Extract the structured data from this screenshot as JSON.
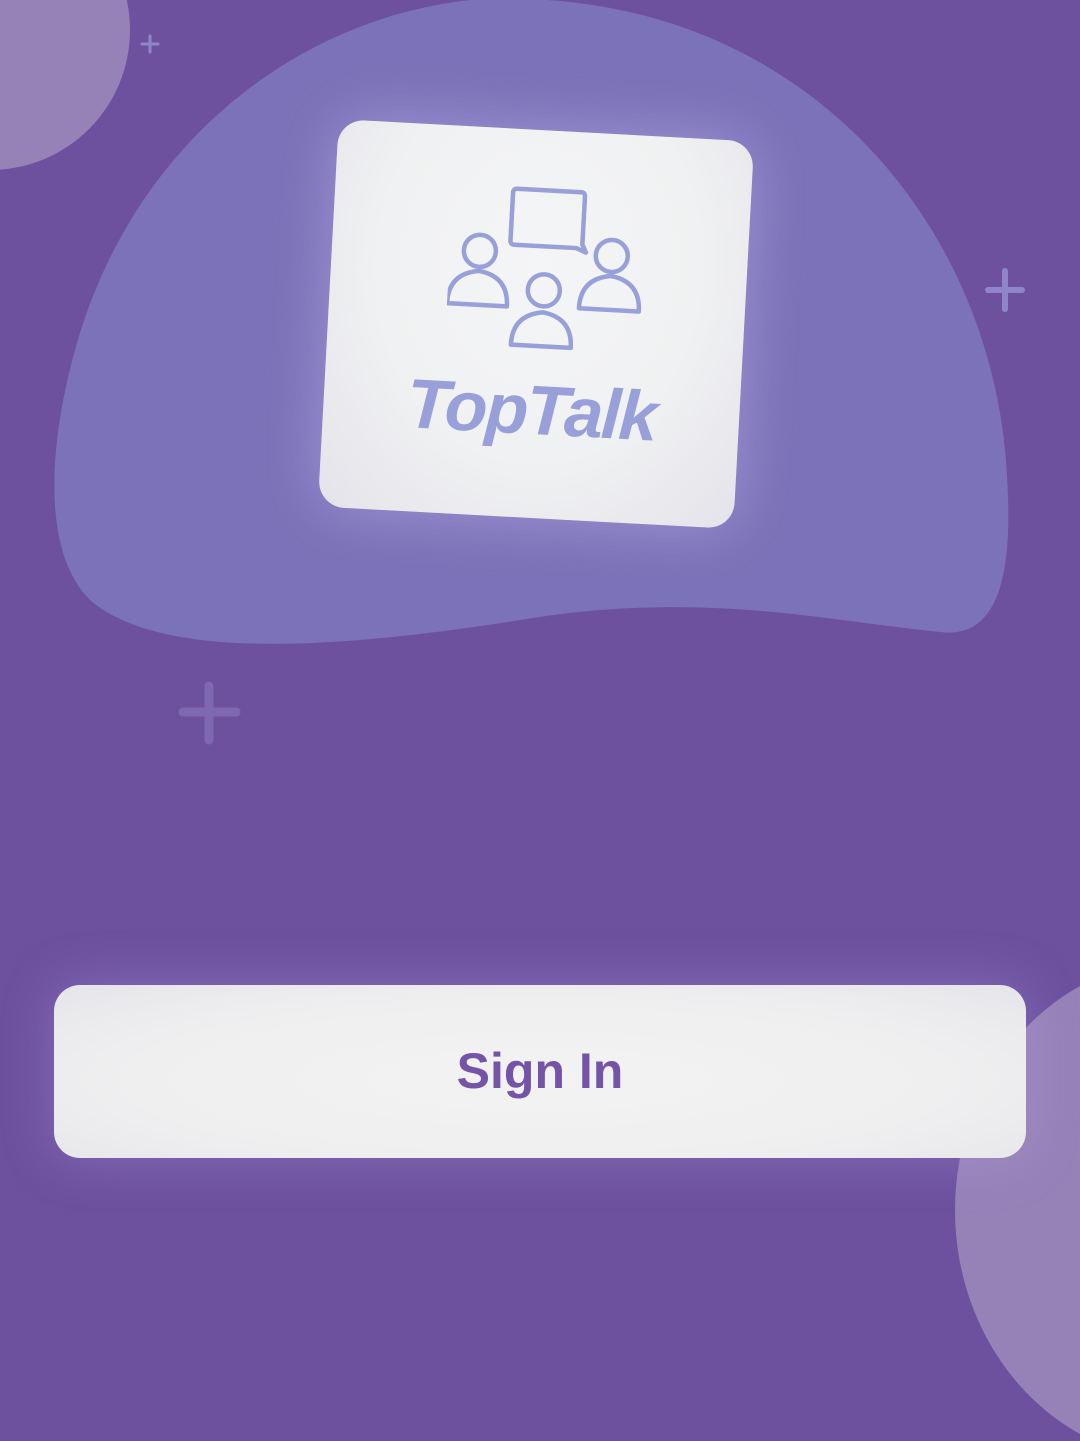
{
  "app": {
    "name": "TopTalk",
    "logo_icon": "group-chat-icon"
  },
  "actions": {
    "sign_in_label": "Sign In"
  },
  "colors": {
    "background": "#6d519f",
    "blob": "#7c72b9",
    "accent_logo": "#989fd9",
    "button_text": "#7454a6",
    "card": "#f0f1f2"
  }
}
